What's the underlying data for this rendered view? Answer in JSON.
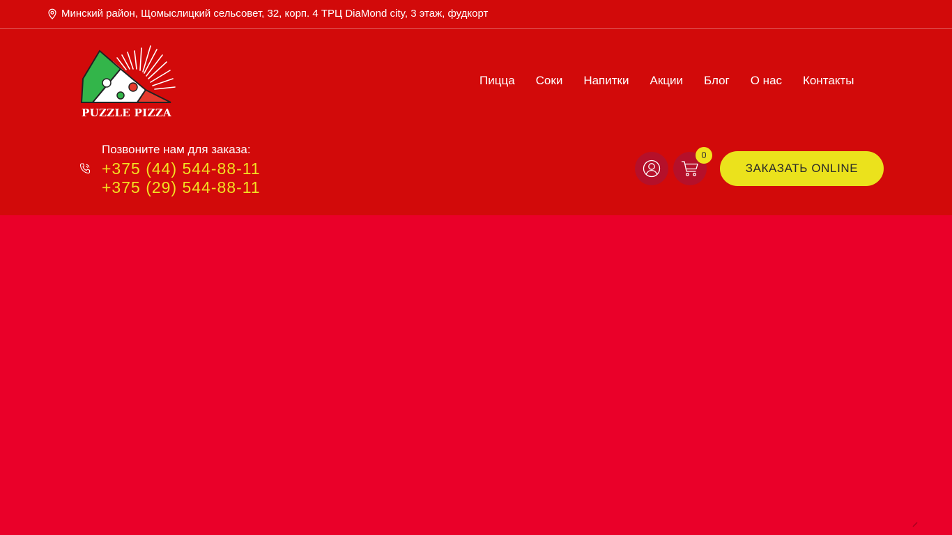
{
  "topbar": {
    "address": "Минский район, Щомыслицкий сельсовет, 32, корп. 4 ТРЦ DiaMond city, 3 этаж, фудкорт",
    "address_icon": "map-pin-icon"
  },
  "brand": {
    "name": "PUZZLE PIZZA",
    "colors": {
      "header_bg": "#d20a0a",
      "page_bg": "#ea0029",
      "accent_yellow": "#ebe21c",
      "icon_circle": "#b5102a"
    }
  },
  "nav": {
    "items": [
      {
        "label": "Пицца"
      },
      {
        "label": "Соки"
      },
      {
        "label": "Напитки"
      },
      {
        "label": "Акции"
      },
      {
        "label": "Блог"
      },
      {
        "label": "О нас"
      },
      {
        "label": "Контакты"
      }
    ]
  },
  "contact": {
    "label": "Позвоните нам для заказа:",
    "phone1": "+375 (44) 544-88-11",
    "phone2": "+375 (29) 544-88-11",
    "icon": "phone-icon"
  },
  "actions": {
    "user_icon": "user-icon",
    "cart_icon": "cart-icon",
    "cart_count": "0",
    "order_label": "ЗАКАЗАТЬ ONLINE"
  }
}
